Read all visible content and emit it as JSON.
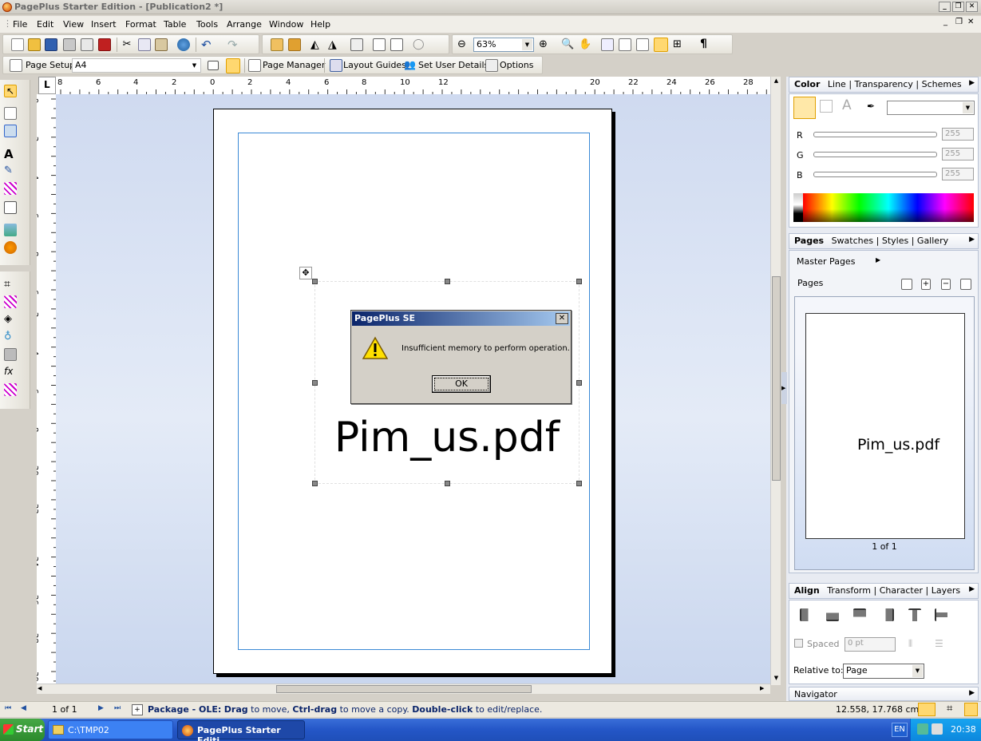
{
  "window": {
    "title": "PagePlus Starter Edition  - [Publication2 *]"
  },
  "menu": [
    "File",
    "Edit",
    "View",
    "Insert",
    "Format",
    "Table",
    "Tools",
    "Arrange",
    "Window",
    "Help"
  ],
  "toolbar": {
    "zoom": "63%"
  },
  "context_bar": {
    "page_setup_label": "Page Setup",
    "page_size": "A4",
    "page_manager": "Page Manager",
    "layout_guides": "Layout Guides",
    "set_user_details": "Set User Details",
    "options": "Options"
  },
  "ruler": {
    "top_labels": [
      "8",
      "6",
      "4",
      "2",
      "0",
      "2",
      "4",
      "6",
      "8",
      "10",
      "12",
      "20",
      "22",
      "24",
      "26",
      "28"
    ],
    "left_labels": [
      "0",
      "2",
      "4",
      "6",
      "8",
      "6",
      "2",
      "4",
      "6",
      "8",
      "20",
      "22",
      "24",
      "26",
      "28",
      "30"
    ]
  },
  "document": {
    "text": "Pim_us.pdf"
  },
  "dialog": {
    "title": "PagePlus SE",
    "message": "Insufficient memory to perform operation.",
    "ok": "OK",
    "close": "✕"
  },
  "color_panel": {
    "tabs": [
      "Color",
      "Line",
      "Transparency",
      "Schemes"
    ],
    "channels": [
      "R",
      "G",
      "B"
    ],
    "values": [
      "255",
      "255",
      "255"
    ]
  },
  "pages_panel": {
    "tabs": [
      "Pages",
      "Swatches",
      "Styles",
      "Gallery"
    ],
    "master_pages": "Master Pages",
    "pages_label": "Pages",
    "thumb_text": "Pim_us.pdf",
    "page_count": "1 of 1"
  },
  "align_panel": {
    "tabs": [
      "Align",
      "Transform",
      "Character",
      "Layers"
    ],
    "spaced": "Spaced",
    "spaced_value": "0 pt",
    "relative_label": "Relative to:",
    "relative_value": "Page"
  },
  "navigator": {
    "label": "Navigator"
  },
  "status": {
    "page": "1 of 1",
    "hint_bold1": "Package - OLE:",
    "hint_bold2": "Drag",
    "hint_t1": " to move, ",
    "hint_bold3": "Ctrl-drag",
    "hint_t2": " to move a copy. ",
    "hint_bold4": "Double-click",
    "hint_t3": " to edit/replace.",
    "coords": "12.558, 17.768 cm"
  },
  "taskbar": {
    "start": "Start",
    "task1": "C:\\TMP02",
    "task2": "PagePlus Starter Editi...",
    "lang": "EN",
    "time": "20:38"
  },
  "colors": {
    "accent": "#0a246a",
    "margin_guide": "#3b8ad6",
    "canvas": "#d6e0f2"
  }
}
